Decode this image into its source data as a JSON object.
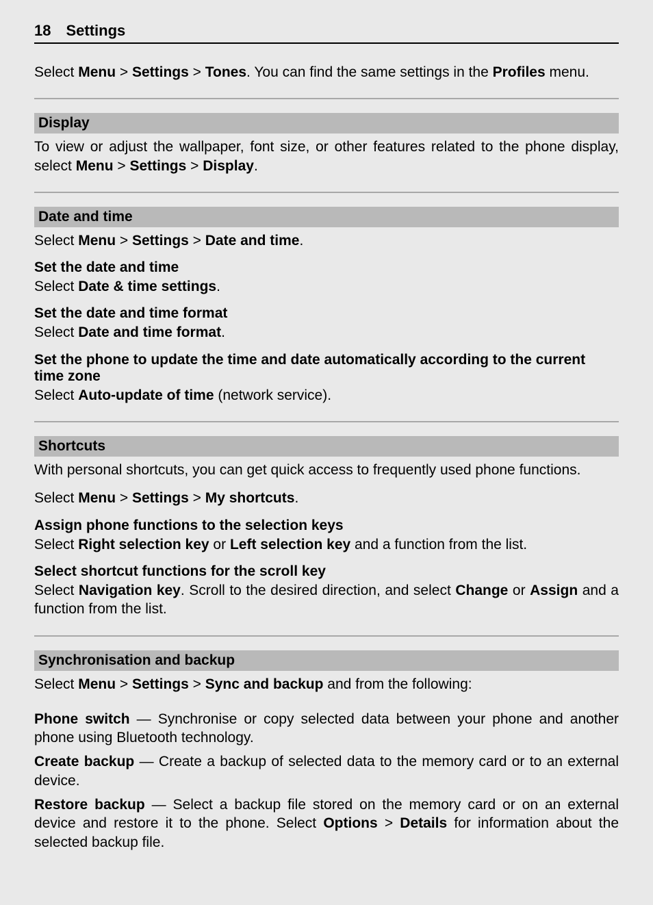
{
  "header": {
    "pageNumber": "18",
    "title": "Settings"
  },
  "tonesPara": {
    "pre": "Select ",
    "menu": "Menu",
    "g1": " > ",
    "settings": "Settings",
    "g2": " > ",
    "tones": "Tones",
    "mid": ". You can find the same settings in the ",
    "profiles": "Profiles",
    "post": " menu."
  },
  "display": {
    "bar": "Display",
    "line1": "To view or adjust the wallpaper, font size, or other features related to the phone display, select ",
    "menu": "Menu",
    "g1": " > ",
    "settings": "Settings",
    "g2": " > ",
    "disp": "Display",
    "post": "."
  },
  "datetime": {
    "bar": "Date and time",
    "sel_pre": "Select ",
    "menu": "Menu",
    "g1": " > ",
    "settings": "Settings",
    "g2": " > ",
    "dt": "Date and time",
    "post": ".",
    "h1": "Set the date and time",
    "h1_pre": "Select ",
    "h1_bold": "Date & time settings",
    "h1_post": ".",
    "h2": "Set the date and time format",
    "h2_pre": "Select ",
    "h2_bold": "Date and time format",
    "h2_post": ".",
    "h3": "Set the phone to update the time and date automatically according to the current time zone",
    "h3_pre": "Select ",
    "h3_bold": "Auto-update of time",
    "h3_post": " (network service)."
  },
  "shortcuts": {
    "bar": "Shortcuts",
    "intro": "With personal shortcuts, you can get quick access to frequently used phone functions.",
    "sel_pre": "Select ",
    "menu": "Menu",
    "g1": " > ",
    "settings": "Settings",
    "g2": " > ",
    "ms": "My shortcuts",
    "post": ".",
    "h1": "Assign phone functions to the selection keys",
    "h1_pre": "Select ",
    "h1_b1": "Right selection key",
    "h1_mid": " or ",
    "h1_b2": "Left selection key",
    "h1_post": " and a function from the list.",
    "h2": "Select shortcut functions for the scroll key",
    "h2_pre": "Select ",
    "h2_b1": "Navigation key",
    "h2_mid1": ". Scroll to the desired direction, and select ",
    "h2_b2": "Change",
    "h2_mid2": " or ",
    "h2_b3": "Assign",
    "h2_post": " and a function from the list."
  },
  "sync": {
    "bar": "Synchronisation and backup",
    "sel_pre": "Select ",
    "menu": "Menu",
    "g1": " > ",
    "settings": "Settings",
    "g2": " > ",
    "sb": "Sync and backup",
    "post": " and from the following:",
    "i1_b": "Phone switch",
    "i1_t": "  — Synchronise or copy selected data between your phone and another phone using Bluetooth technology.",
    "i2_b": "Create backup",
    "i2_t": "  — Create a backup of selected data to the memory card or to an external device.",
    "i3_b": "Restore backup",
    "i3_t1": "  —  Select a backup file stored on the memory card or on an external device and restore it to the phone. Select ",
    "i3_opt": "Options",
    "i3_g": " > ",
    "i3_det": "Details",
    "i3_t2": " for information about the selected backup file."
  }
}
